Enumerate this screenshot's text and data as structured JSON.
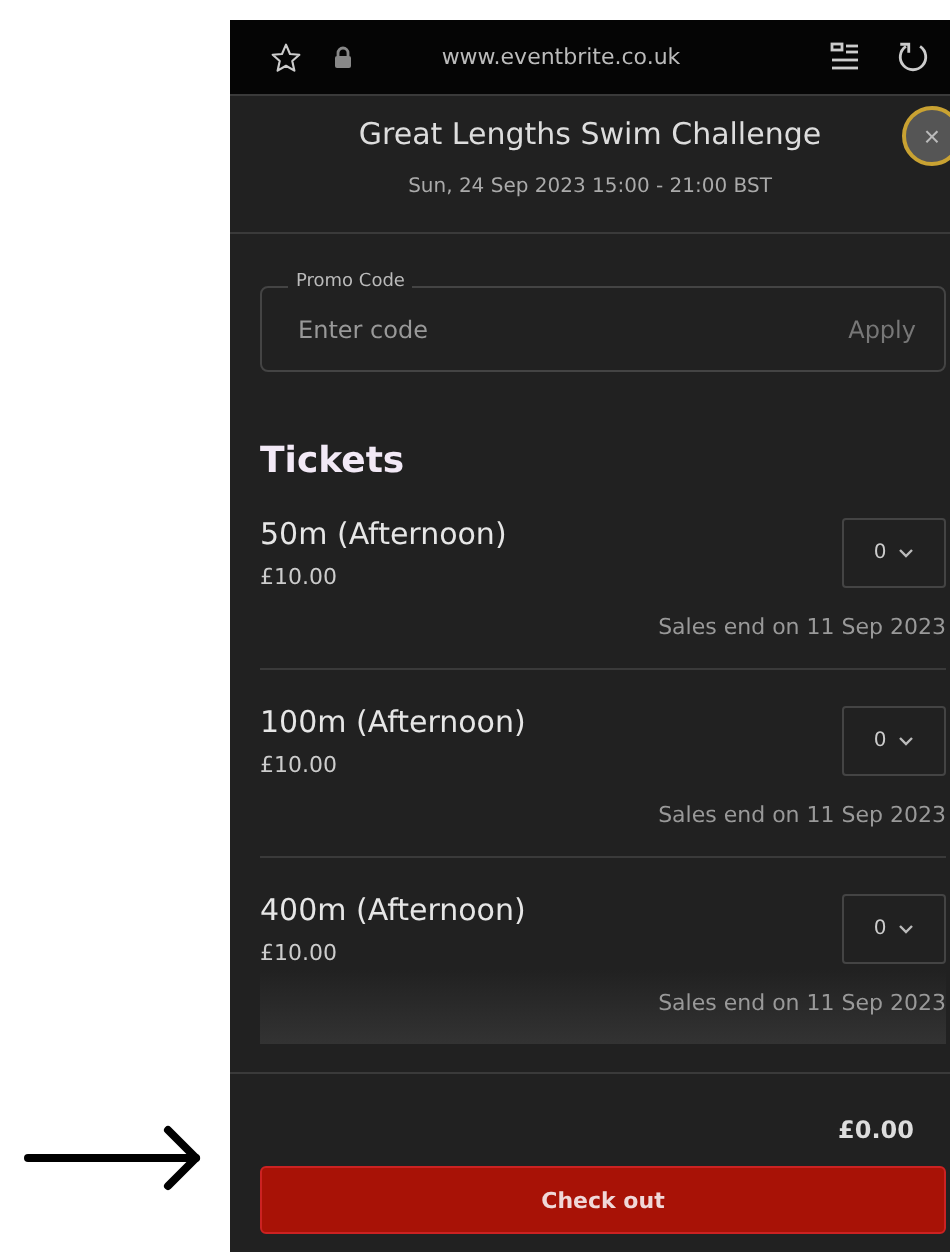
{
  "browser": {
    "url": "www.eventbrite.co.uk"
  },
  "header": {
    "title": "Great Lengths Swim Challenge",
    "close": "×",
    "date": "Sun, 24 Sep 2023 15:00 - 21:00 BST"
  },
  "promo": {
    "label": "Promo Code",
    "placeholder": "Enter code",
    "action": "Apply"
  },
  "tickets_heading": "Tickets",
  "tickets": [
    {
      "name": "50m (Afternoon)",
      "price": "£10.00",
      "quantity": "0",
      "sales_end": "Sales end on 11 Sep 2023"
    },
    {
      "name": "100m (Afternoon)",
      "price": "£10.00",
      "quantity": "0",
      "sales_end": "Sales end on 11 Sep 2023"
    },
    {
      "name": "400m (Afternoon)",
      "price": "£10.00",
      "quantity": "0",
      "sales_end": "Sales end on 11 Sep 2023"
    }
  ],
  "total": "£0.00",
  "checkout_button": "Check out"
}
